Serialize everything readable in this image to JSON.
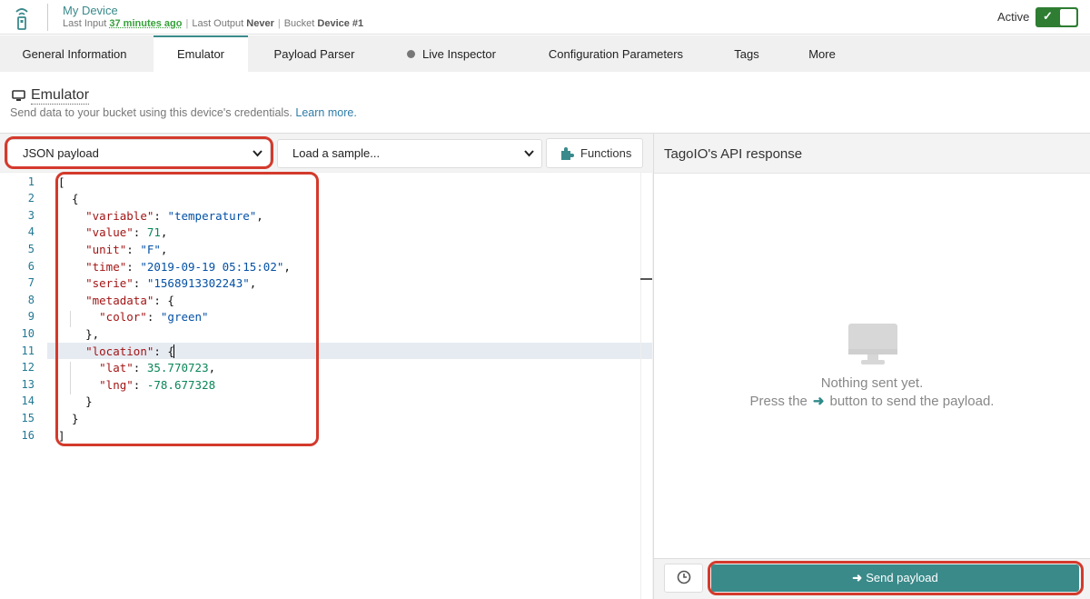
{
  "header": {
    "device_name": "My Device",
    "last_input_label": "Last Input",
    "last_input_value": "37 minutes ago",
    "last_output_label": "Last Output",
    "last_output_value": "Never",
    "bucket_label": "Bucket",
    "bucket_value": "Device #1",
    "active_label": "Active",
    "active_on": true,
    "accent_color": "#3a8a8b",
    "toggle_color": "#2e7d32"
  },
  "tabs": [
    {
      "label": "General Information",
      "active": false
    },
    {
      "label": "Emulator",
      "active": true
    },
    {
      "label": "Payload Parser",
      "active": false
    },
    {
      "label": "Live Inspector",
      "active": false,
      "icon": "status-dot-icon"
    },
    {
      "label": "Configuration Parameters",
      "active": false
    },
    {
      "label": "Tags",
      "active": false
    },
    {
      "label": "More",
      "active": false
    }
  ],
  "section": {
    "icon": "monitor-icon",
    "title": "Emulator",
    "description": "Send data to your bucket using this device's credentials.",
    "learn_more": "Learn more."
  },
  "controls": {
    "payload_type_value": "JSON payload",
    "sample_value": "Load a sample...",
    "functions_label": "Functions",
    "functions_icon": "puzzle-icon"
  },
  "editor": {
    "line_numbers": [
      "1",
      "2",
      "3",
      "4",
      "5",
      "6",
      "7",
      "8",
      "9",
      "10",
      "11",
      "12",
      "13",
      "14",
      "15",
      "16"
    ],
    "lines": [
      "[",
      "  {",
      "    \"variable\": \"temperature\",",
      "    \"value\": 71,",
      "    \"unit\": \"F\",",
      "    \"time\": \"2019-09-19 05:15:02\",",
      "    \"serie\": \"1568913302243\",",
      "    \"metadata\": {",
      "      \"color\": \"green\"",
      "    },",
      "    \"location\": {",
      "      \"lat\": 35.770723,",
      "      \"lng\": -78.677328",
      "    }",
      "  }",
      "]"
    ],
    "payload": {
      "variable": "temperature",
      "value": 71,
      "unit": "F",
      "time": "2019-09-19 05:15:02",
      "serie": "1568913302243",
      "metadata": {
        "color": "green"
      },
      "location": {
        "lat": 35.770723,
        "lng": -78.677328
      }
    }
  },
  "response": {
    "title": "TagoIO's API response",
    "empty_icon": "monitor-icon",
    "nothing_sent": "Nothing sent yet.",
    "press_before": "Press the",
    "press_after": "button to send the payload.",
    "arrow_icon": "arrow-right-icon"
  },
  "footer": {
    "history_icon": "clock-icon",
    "send_label": "Send payload",
    "send_icon": "arrow-right-icon",
    "send_color": "#3b8a8a"
  },
  "highlight_color": "#d33a2c"
}
